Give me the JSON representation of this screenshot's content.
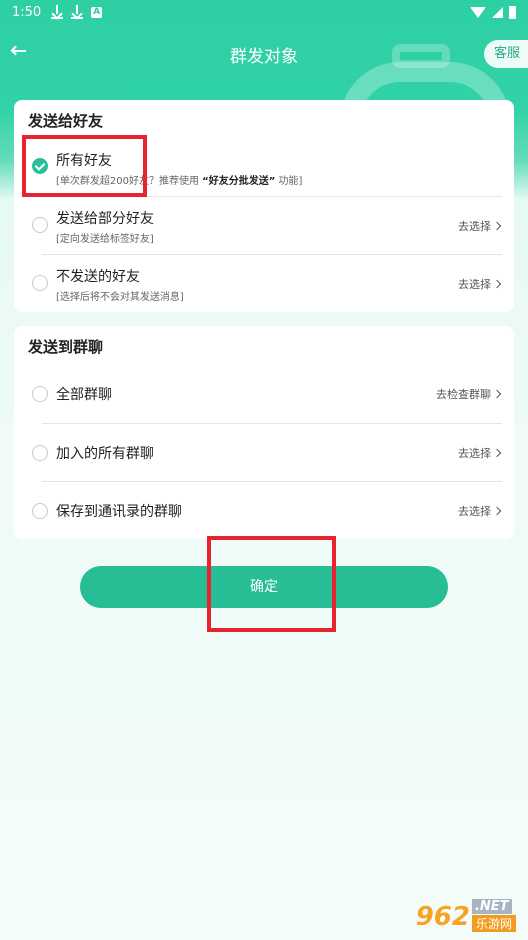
{
  "status_bar": {
    "time": "1:50",
    "icon_a": "A"
  },
  "header": {
    "back_icon": "back-arrow-icon",
    "title": "群发对象",
    "service_label": "客服"
  },
  "friends_section": {
    "title": "发送给好友",
    "options": [
      {
        "label": "所有好友",
        "sub_prefix": "[单次群发超200好友？推荐使用 ",
        "sub_bold": "“好友分批发送”",
        "sub_suffix": " 功能]",
        "action": "",
        "checked": true
      },
      {
        "label": "发送给部分好友",
        "sub_prefix": "[定向发送给标签好友]",
        "sub_bold": "",
        "sub_suffix": "",
        "action": "去选择",
        "checked": false
      },
      {
        "label": "不发送的好友",
        "sub_prefix": "[选择后将不会对其发送消息]",
        "sub_bold": "",
        "sub_suffix": "",
        "action": "去选择",
        "checked": false
      }
    ]
  },
  "groups_section": {
    "title": "发送到群聊",
    "options": [
      {
        "label": "全部群聊",
        "action": "去检查群聊",
        "checked": false
      },
      {
        "label": "加入的所有群聊",
        "action": "去选择",
        "checked": false
      },
      {
        "label": "保存到通讯录的群聊",
        "action": "去选择",
        "checked": false
      }
    ]
  },
  "confirm_label": "确定",
  "watermark": {
    "num": "962",
    "net": ".NET",
    "site": "乐游网"
  },
  "colors": {
    "accent": "#27be96",
    "highlight": "#e6232e",
    "header": "#2ecfa4"
  }
}
